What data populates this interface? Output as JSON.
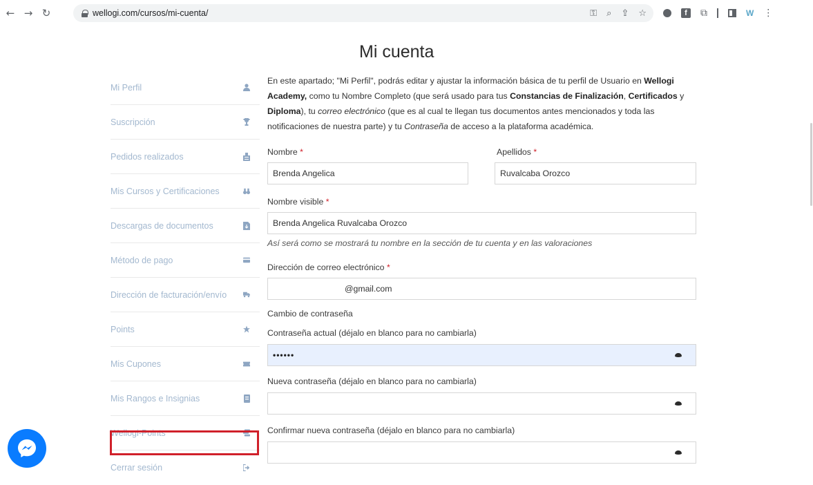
{
  "browser": {
    "url": "wellogi.com/cursos/mi-cuenta/",
    "ext_f_label": "f",
    "ext_w_label": "W"
  },
  "page": {
    "title": "Mi cuenta"
  },
  "sidebar": {
    "items": [
      {
        "label": "Mi Perfil",
        "icon": "user-icon"
      },
      {
        "label": "Suscripción",
        "icon": "trophy-icon"
      },
      {
        "label": "Pedidos realizados",
        "icon": "orders-icon"
      },
      {
        "label": "Mis Cursos y Certificaciones",
        "icon": "binoculars-icon"
      },
      {
        "label": "Descargas de documentos",
        "icon": "file-download-icon"
      },
      {
        "label": "Método de pago",
        "icon": "credit-card-icon"
      },
      {
        "label": "Dirección de facturación/envío",
        "icon": "truck-icon"
      },
      {
        "label": "Points",
        "icon": "star-icon"
      },
      {
        "label": "Mis Cupones",
        "icon": "coupon-icon"
      },
      {
        "label": "Mis Rangos e Insignias",
        "icon": "badge-icon"
      },
      {
        "label": "Wellogi-Points",
        "icon": "coins-icon"
      },
      {
        "label": "Cerrar sesión",
        "icon": "logout-icon"
      }
    ]
  },
  "intro": {
    "p1": "En este apartado; \"Mi Perfil\", podrás editar y ajustar la información básica de tu perfil de Usuario en ",
    "b1": "Wellogi Academy,",
    "p2": " como tu Nombre Completo (que será usado para tus ",
    "b2": "Constancias de Finalización",
    "p3": ", ",
    "b3": "Certificados",
    "p4": " y ",
    "b4": "Diploma",
    "p5": "), tu ",
    "i1": "correo electrónico",
    "p6": " (que es al cual te llegan tus documentos antes mencionados y toda las notificaciones de nuestra parte) y tu ",
    "i2": "Contraseña",
    "p7": " de acceso a la plataforma académica."
  },
  "form": {
    "nombre_label": "Nombre",
    "nombre_value": "Brenda Angelica",
    "apellidos_label": "Apellidos",
    "apellidos_value": "Ruvalcaba Orozco",
    "visible_label": "Nombre visible",
    "visible_value": "Brenda Angelica Ruvalcaba Orozco",
    "visible_hint": "Así será como se mostrará tu nombre en la sección de tu cuenta y en las valoraciones",
    "email_label": "Dirección de correo electrónico",
    "email_value": "@gmail.com",
    "required_mark": "*",
    "password_section": "Cambio de contraseña",
    "current_pw_label": "Contraseña actual (déjalo en blanco para no cambiarla)",
    "current_pw_value": "••••••",
    "new_pw_label": "Nueva contraseña (déjalo en blanco para no cambiarla)",
    "confirm_pw_label": "Confirmar nueva contraseña (déjalo en blanco para no cambiarla)"
  },
  "colors": {
    "sidebar_text": "#a3b8cf",
    "highlight_border": "#d0202a",
    "required": "#d0202a",
    "autofill_bg": "#e8f0fe",
    "messenger": "#0a7cff"
  }
}
